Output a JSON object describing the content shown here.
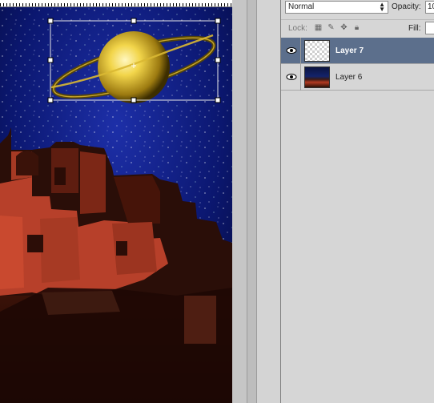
{
  "layers_panel": {
    "blend_mode": "Normal",
    "opacity_label": "Opacity:",
    "opacity_value": "10",
    "lock_label": "Lock:",
    "fill_label": "Fill:",
    "fill_value": "",
    "layers": [
      {
        "name": "Layer 7",
        "selected": true,
        "visible": true,
        "thumbnail": "transparent"
      },
      {
        "name": "Layer 6",
        "selected": false,
        "visible": true,
        "thumbnail": "night-village"
      }
    ]
  },
  "canvas": {
    "content": "night village with ringed planet",
    "transform_handles": true
  },
  "colors": {
    "selection": "#5c6f8c",
    "sky": "#0a1460",
    "buildings": "#c0432a",
    "planet": "#d8b82a"
  },
  "icons": [
    "eye-icon",
    "lock-transparency-icon",
    "brush-icon",
    "move-icon",
    "lock-icon",
    "dropdown-arrow-icon"
  ]
}
